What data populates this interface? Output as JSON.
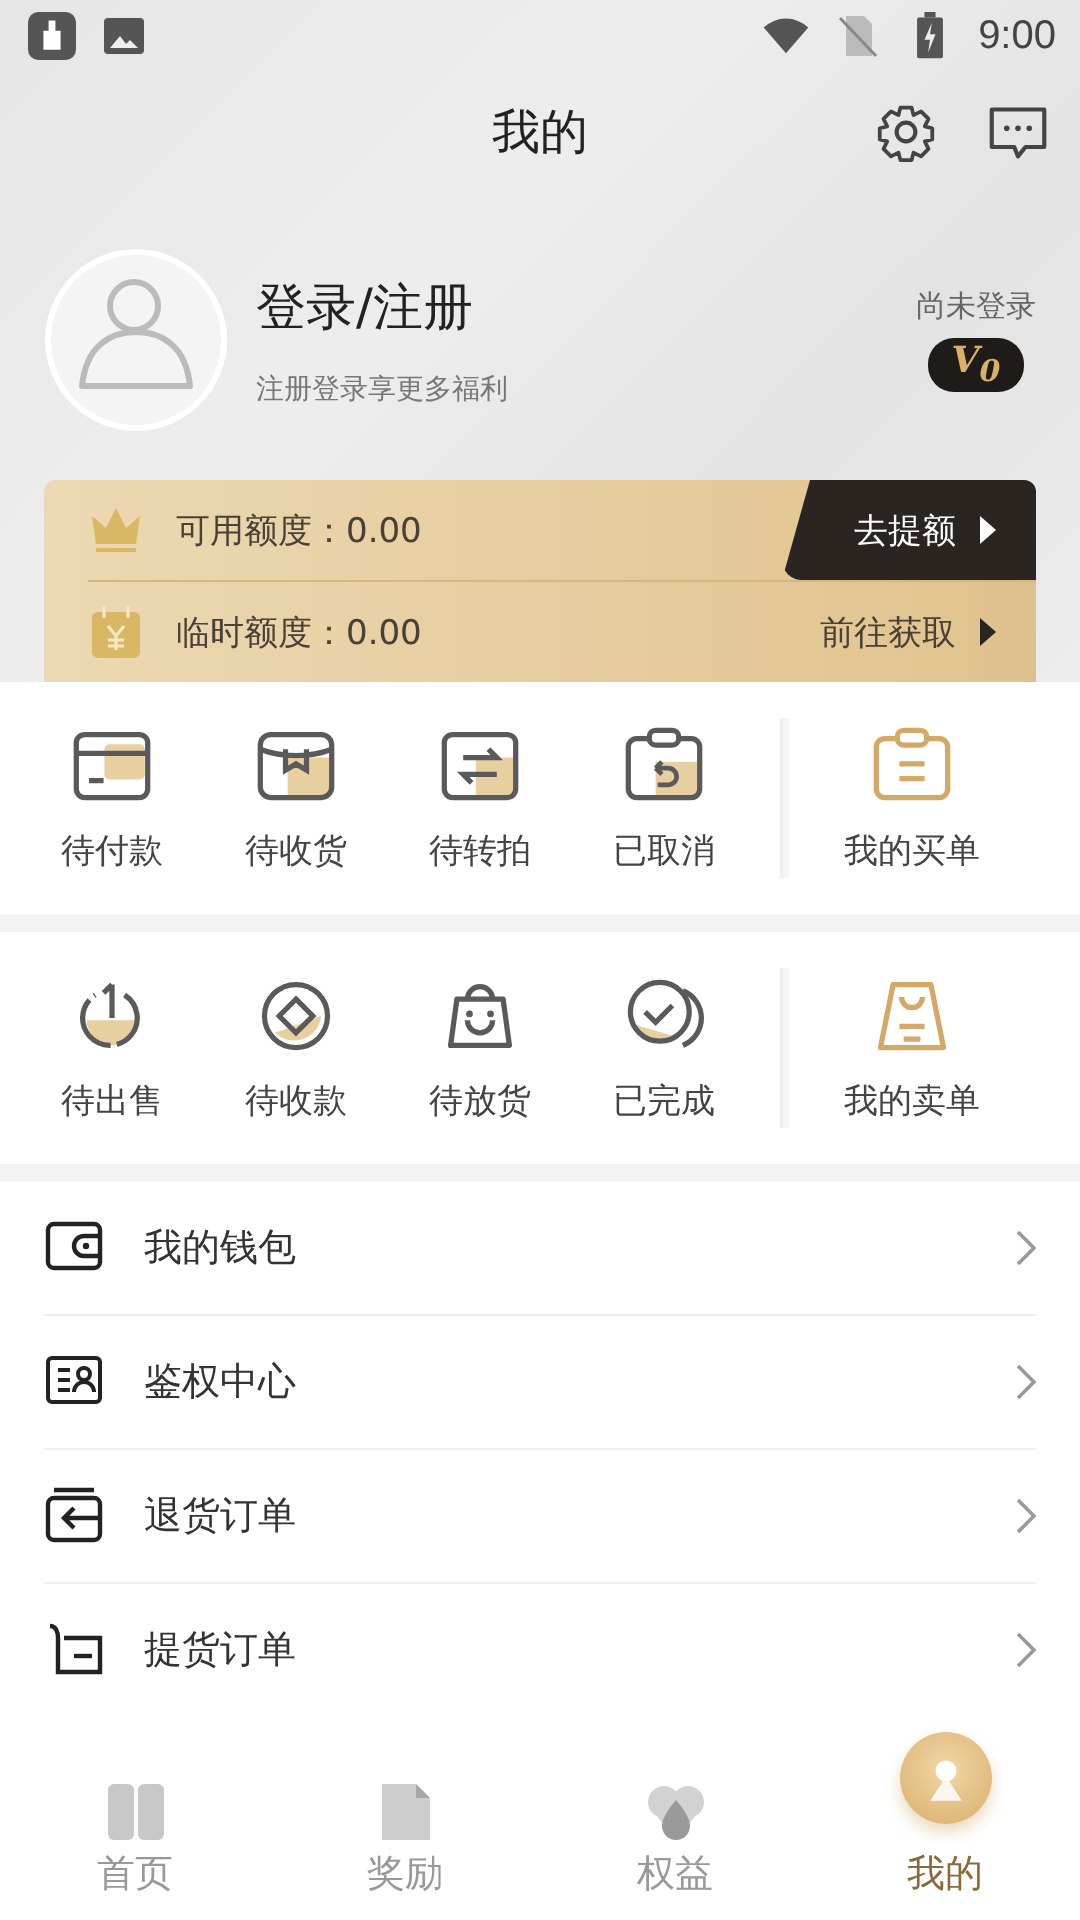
{
  "status_bar": {
    "time": "9:00"
  },
  "header": {
    "title": "我的"
  },
  "profile": {
    "name": "登录/注册",
    "subtitle": "注册登录享更多福利",
    "status": "尚未登录",
    "vip_badge": "V$_{0}$"
  },
  "credit": [
    {
      "kind": "primary",
      "label": "可用额度：0.00",
      "action": "去提额"
    },
    {
      "kind": "secondary",
      "label": "临时额度：0.00",
      "action": "前往获取"
    }
  ],
  "order_groups": [
    {
      "items": [
        "待付款",
        "待收货",
        "待转拍",
        "已取消"
      ],
      "summary": "我的买单"
    },
    {
      "items": [
        "待出售",
        "待收款",
        "待放货",
        "已完成"
      ],
      "summary": "我的卖单"
    }
  ],
  "menu": [
    "我的钱包",
    "鉴权中心",
    "退货订单",
    "提货订单"
  ],
  "nav": [
    {
      "label": "首页",
      "selected": false
    },
    {
      "label": "奖励",
      "selected": false
    },
    {
      "label": "权益",
      "selected": false
    },
    {
      "label": "我的",
      "selected": true
    }
  ]
}
